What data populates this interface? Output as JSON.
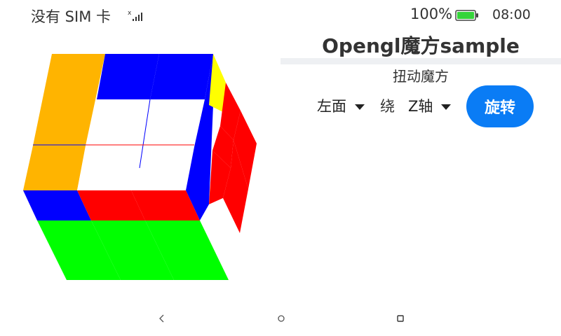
{
  "status_bar": {
    "carrier": "没有 SIM 卡",
    "battery_percent": "100%",
    "time": "08:00"
  },
  "header": {
    "title": "Opengl魔方sample",
    "subtitle": "扭动魔方"
  },
  "controls": {
    "face_select_value": "左面",
    "around_label": "绕",
    "axis_select_value": "Z轴",
    "rotate_button_label": "旋转"
  },
  "cube_colors": {
    "orange": "#ffb400",
    "blue": "#0000ff",
    "white": "#ffffff",
    "red": "#ff0000",
    "green": "#00ff00",
    "yellow": "#ffff00"
  },
  "accent_color": "#0a7cf5",
  "nav_bar": {
    "back_icon": "back-triangle-icon",
    "home_icon": "home-circle-icon",
    "recent_icon": "recent-square-icon"
  }
}
